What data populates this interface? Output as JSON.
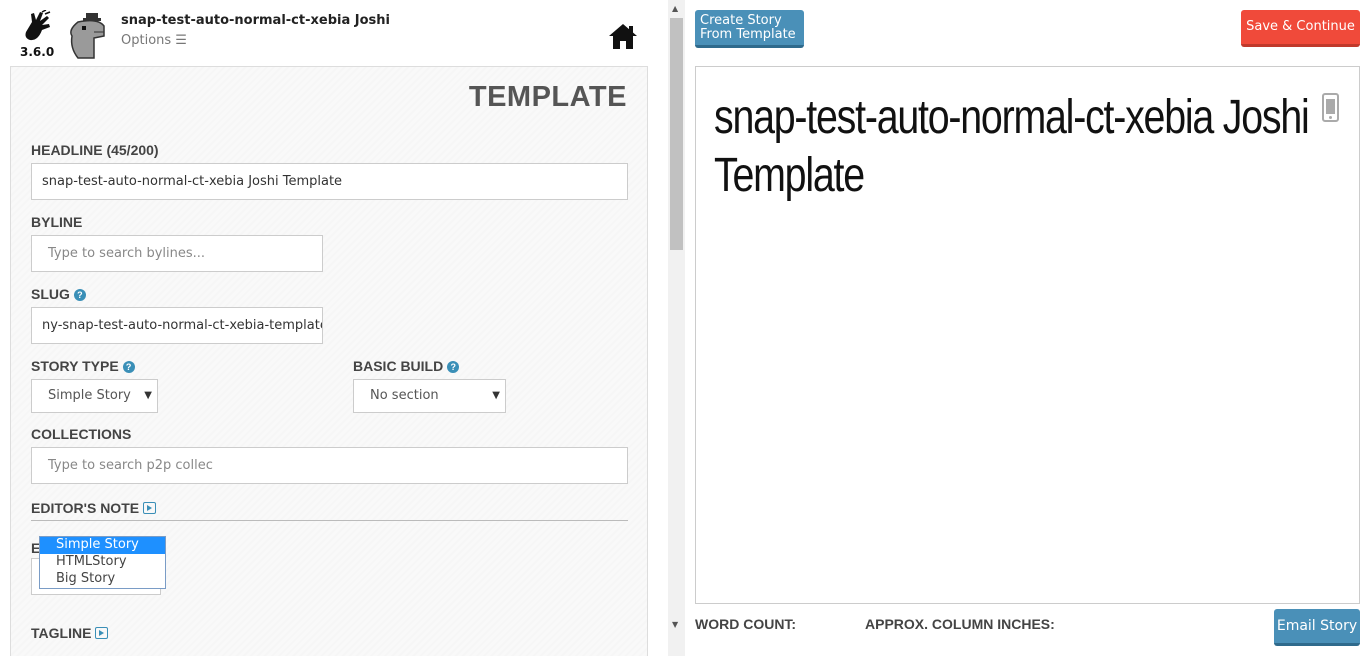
{
  "app": {
    "version": "3.6.0",
    "story_title": "snap-test-auto-normal-ct-xebia Joshi",
    "options_label": "Options ☰"
  },
  "form": {
    "heading": "TEMPLATE",
    "headline": {
      "label": "HEADLINE (45/200)",
      "value": "snap-test-auto-normal-ct-xebia Joshi Template"
    },
    "byline": {
      "label": "BYLINE",
      "placeholder": "Type to search bylines..."
    },
    "slug": {
      "label": "SLUG",
      "value": "ny-snap-test-auto-normal-ct-xebia-template"
    },
    "story_type": {
      "label": "STORY TYPE",
      "value": "Simple Story",
      "options": [
        "Simple Story",
        "HTMLStory",
        "Big Story"
      ]
    },
    "basic_build": {
      "label": "BASIC BUILD",
      "value": "No section"
    },
    "collections": {
      "label": "COLLECTIONS",
      "placeholder": "Type to search p2p collec"
    },
    "editors_note": {
      "label": "EDITOR'S NOTE"
    },
    "hidden_field_label": "E",
    "tagline": {
      "label": "TAGLINE"
    }
  },
  "preview": {
    "create_template_label": "Create Story From Template",
    "save_continue_label": "Save & Continue",
    "headline": "snap-test-auto-normal-ct-xebia Joshi Template",
    "word_count_label": "WORD COUNT:",
    "column_inches_label": "APPROX. COLUMN INCHES:",
    "email_story_label": "Email Story"
  },
  "colors": {
    "accent_blue": "#4a90b8",
    "save_red": "#f04a3a",
    "help_blue": "#3a8fb7",
    "dropdown_selected": "#1e90ff"
  }
}
